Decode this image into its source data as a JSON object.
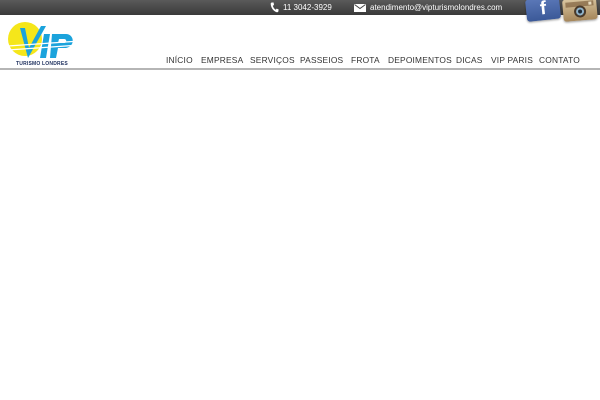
{
  "topbar": {
    "phone": "11 3042-3929",
    "email": "atendimento@vipturismolondres.com"
  },
  "social": {
    "facebook_letter": "f",
    "facebook_icon": "facebook-icon",
    "instagram_icon": "instagram-icon"
  },
  "logo": {
    "text": "VIP",
    "subtitle": "TURISMO LONDRES",
    "colors": {
      "sun": "#f5e61a",
      "letters": "#1ba3dc",
      "subtitle": "#1a2c5b"
    }
  },
  "nav": {
    "items": [
      "INÍCIO",
      "EMPRESA",
      "SERVIÇOS",
      "PASSEIOS",
      "FROTA",
      "DEPOIMENTOS",
      "DICAS",
      "VIP PARIS",
      "CONTATO"
    ]
  },
  "colors": {
    "topbar": "#444444",
    "nav_text": "#333333",
    "divider": "#b5b5b5"
  }
}
